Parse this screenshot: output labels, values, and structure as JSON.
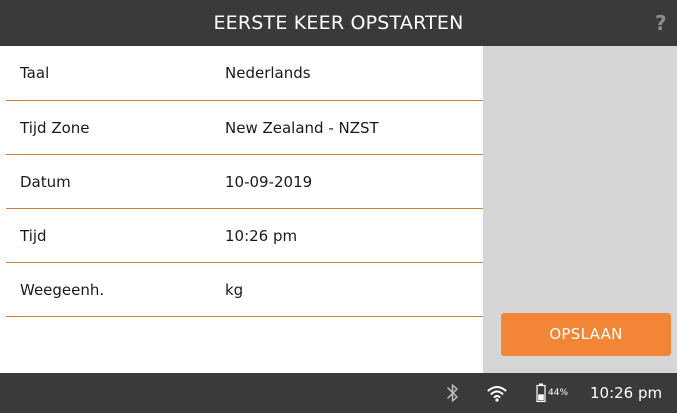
{
  "header": {
    "title": "EERSTE KEER OPSTARTEN",
    "help_label": "?"
  },
  "settings": [
    {
      "label": "Taal",
      "value": "Nederlands"
    },
    {
      "label": "Tijd Zone",
      "value": "New Zealand - NZST"
    },
    {
      "label": "Datum",
      "value": "10-09-2019"
    },
    {
      "label": "Tijd",
      "value": "10:26 pm"
    },
    {
      "label": "Weegeenh.",
      "value": "kg"
    }
  ],
  "actions": {
    "save_label": "OPSLAAN"
  },
  "status_bar": {
    "icons": [
      "bluetooth-icon",
      "wifi-icon",
      "battery-icon"
    ],
    "battery_percent": "44%",
    "battery_level": 0.44,
    "time": "10:26 pm"
  },
  "colors": {
    "bar_background": "#3a3a3a",
    "accent": "#f28636",
    "divider": "#c9843e",
    "side_panel": "#d6d6d6"
  }
}
